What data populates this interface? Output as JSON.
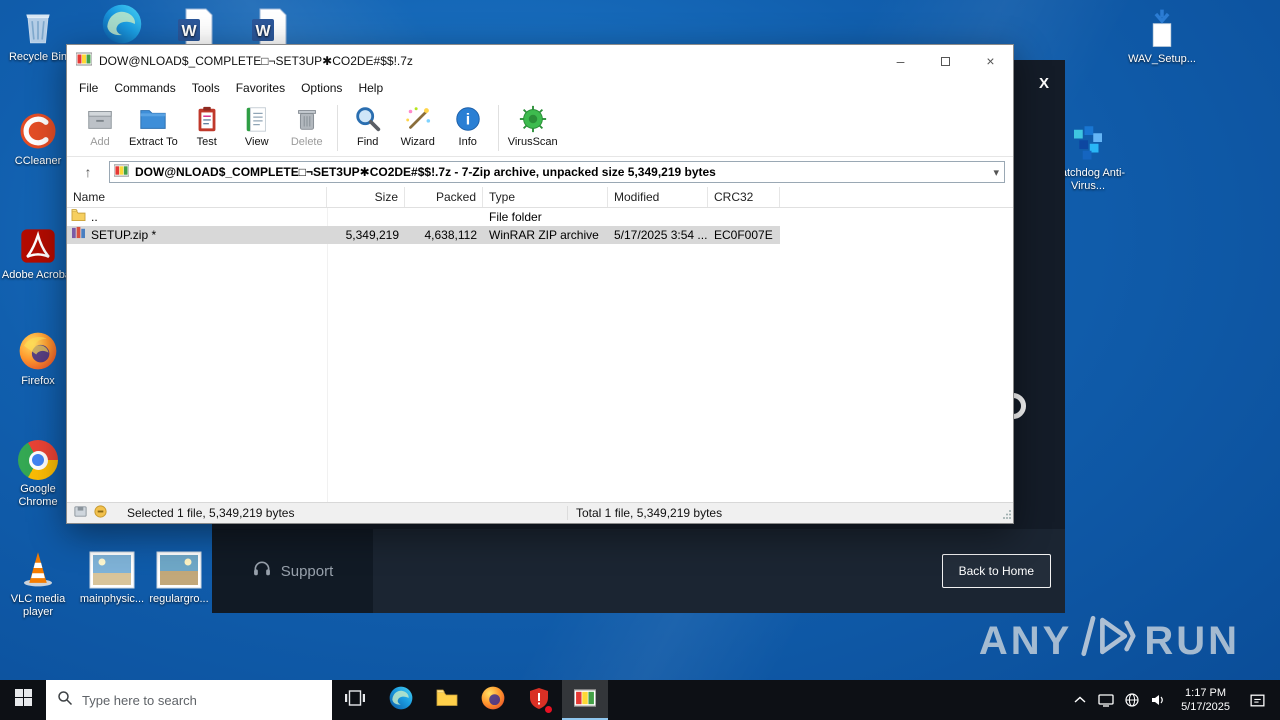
{
  "desktop": {
    "icons": {
      "recycle_bin": "Recycle Bin",
      "ccleaner": "CCleaner",
      "adobe": "Adobe Acrobat",
      "firefox": "Firefox",
      "chrome": "Google Chrome",
      "vlc": "VLC media player",
      "wav_setup": "WAV_Setup...",
      "watchdog": "Watchdog Anti-Virus...",
      "photo_main": "mainphysic...",
      "photo_regular": "regulargro..."
    },
    "watermark": {
      "left": "ANY",
      "right": "RUN"
    }
  },
  "installer": {
    "close": "X",
    "support": "Support",
    "back_home": "Back to Home"
  },
  "app": {
    "title": "DOW@NLOAD$_COMPLETE□¬SET3UP✱CO2DE#$$!.7z",
    "controls": {
      "minimize": "–",
      "close": "×"
    },
    "menu": [
      "File",
      "Commands",
      "Tools",
      "Favorites",
      "Options",
      "Help"
    ],
    "toolbar": {
      "add": "Add",
      "extract": "Extract To",
      "test": "Test",
      "view": "View",
      "delete": "Delete",
      "find": "Find",
      "wizard": "Wizard",
      "info": "Info",
      "virusscan": "VirusScan"
    },
    "address": {
      "up": "↑",
      "value": "DOW@NLOAD$_COMPLETE□¬SET3UP✱CO2DE#$$!.7z - 7-Zip archive, unpacked size 5,349,219 bytes",
      "dropdown": "▾"
    },
    "columns": [
      "Name",
      "Size",
      "Packed",
      "Type",
      "Modified",
      "CRC32"
    ],
    "rows": [
      {
        "name": "..",
        "size": "",
        "packed": "",
        "type": "File folder",
        "modified": "",
        "crc32": ""
      },
      {
        "name": "SETUP.zip *",
        "size": "5,349,219",
        "packed": "4,638,112",
        "type": "WinRAR ZIP archive",
        "modified": "5/17/2025 3:54 ...",
        "crc32": "EC0F007E"
      }
    ],
    "status": {
      "selected": "Selected 1 file, 5,349,219 bytes",
      "total": "Total 1 file, 5,349,219 bytes"
    }
  },
  "taskbar": {
    "search_placeholder": "Type here to search",
    "clock": {
      "time": "1:17 PM",
      "date": "5/17/2025"
    }
  }
}
